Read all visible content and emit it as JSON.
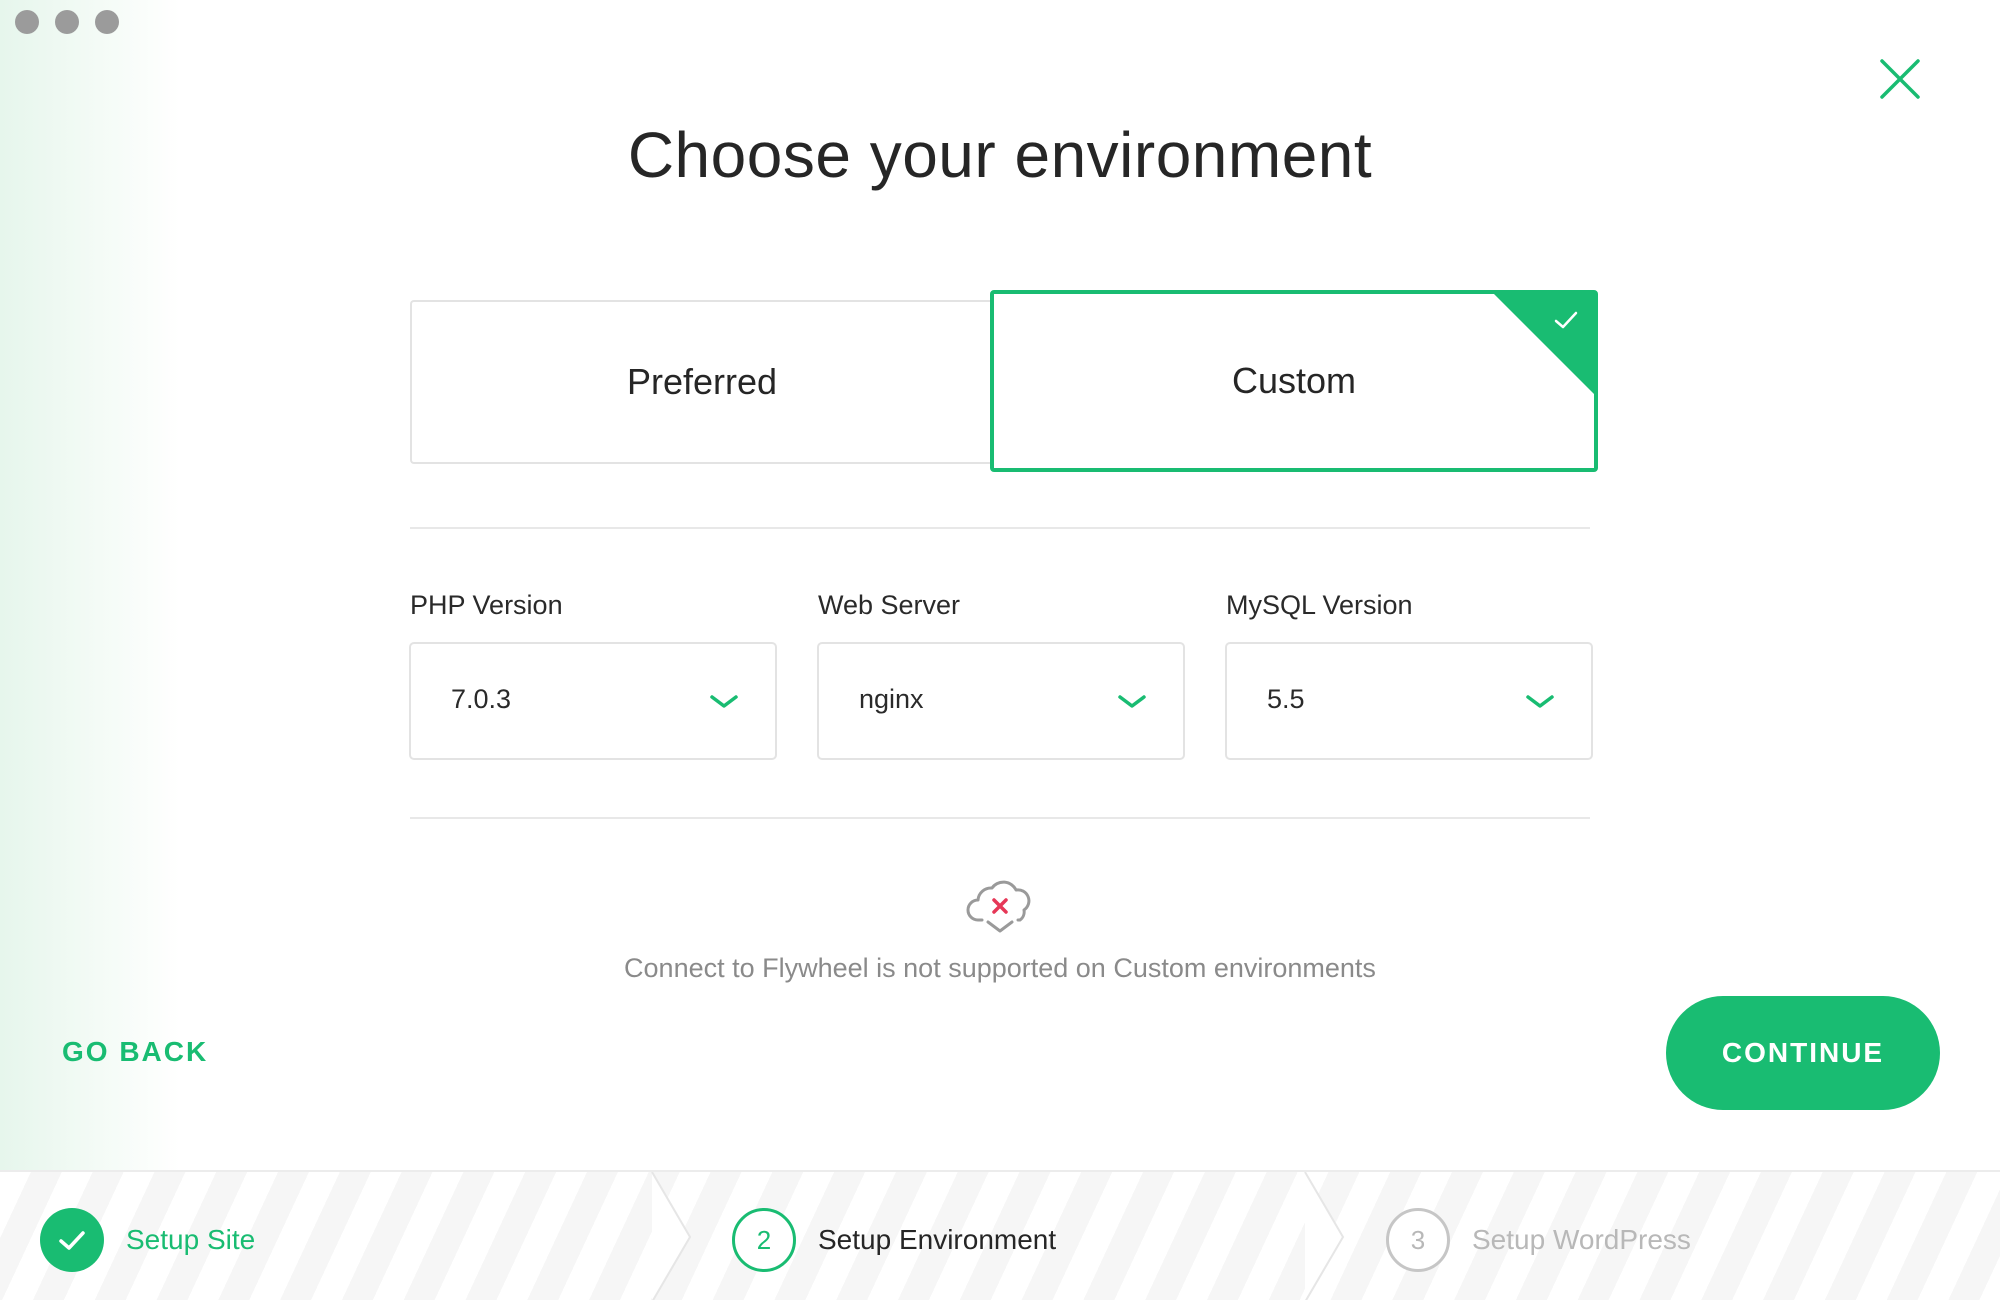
{
  "title": "Choose your environment",
  "options": {
    "preferred": "Preferred",
    "custom": "Custom",
    "selected": "custom"
  },
  "fields": [
    {
      "label": "PHP Version",
      "value": "7.0.3"
    },
    {
      "label": "Web Server",
      "value": "nginx"
    },
    {
      "label": "MySQL Version",
      "value": "5.5"
    }
  ],
  "notice": "Connect to Flywheel is not supported on Custom environments",
  "actions": {
    "go_back": "GO BACK",
    "continue": "CONTINUE"
  },
  "steps": [
    {
      "number": "1",
      "label": "Setup Site",
      "state": "complete"
    },
    {
      "number": "2",
      "label": "Setup Environment",
      "state": "active"
    },
    {
      "number": "3",
      "label": "Setup WordPress",
      "state": "upcoming"
    }
  ],
  "colors": {
    "accent": "#19bc72",
    "error": "#e63757",
    "muted": "#8a8a8a"
  }
}
